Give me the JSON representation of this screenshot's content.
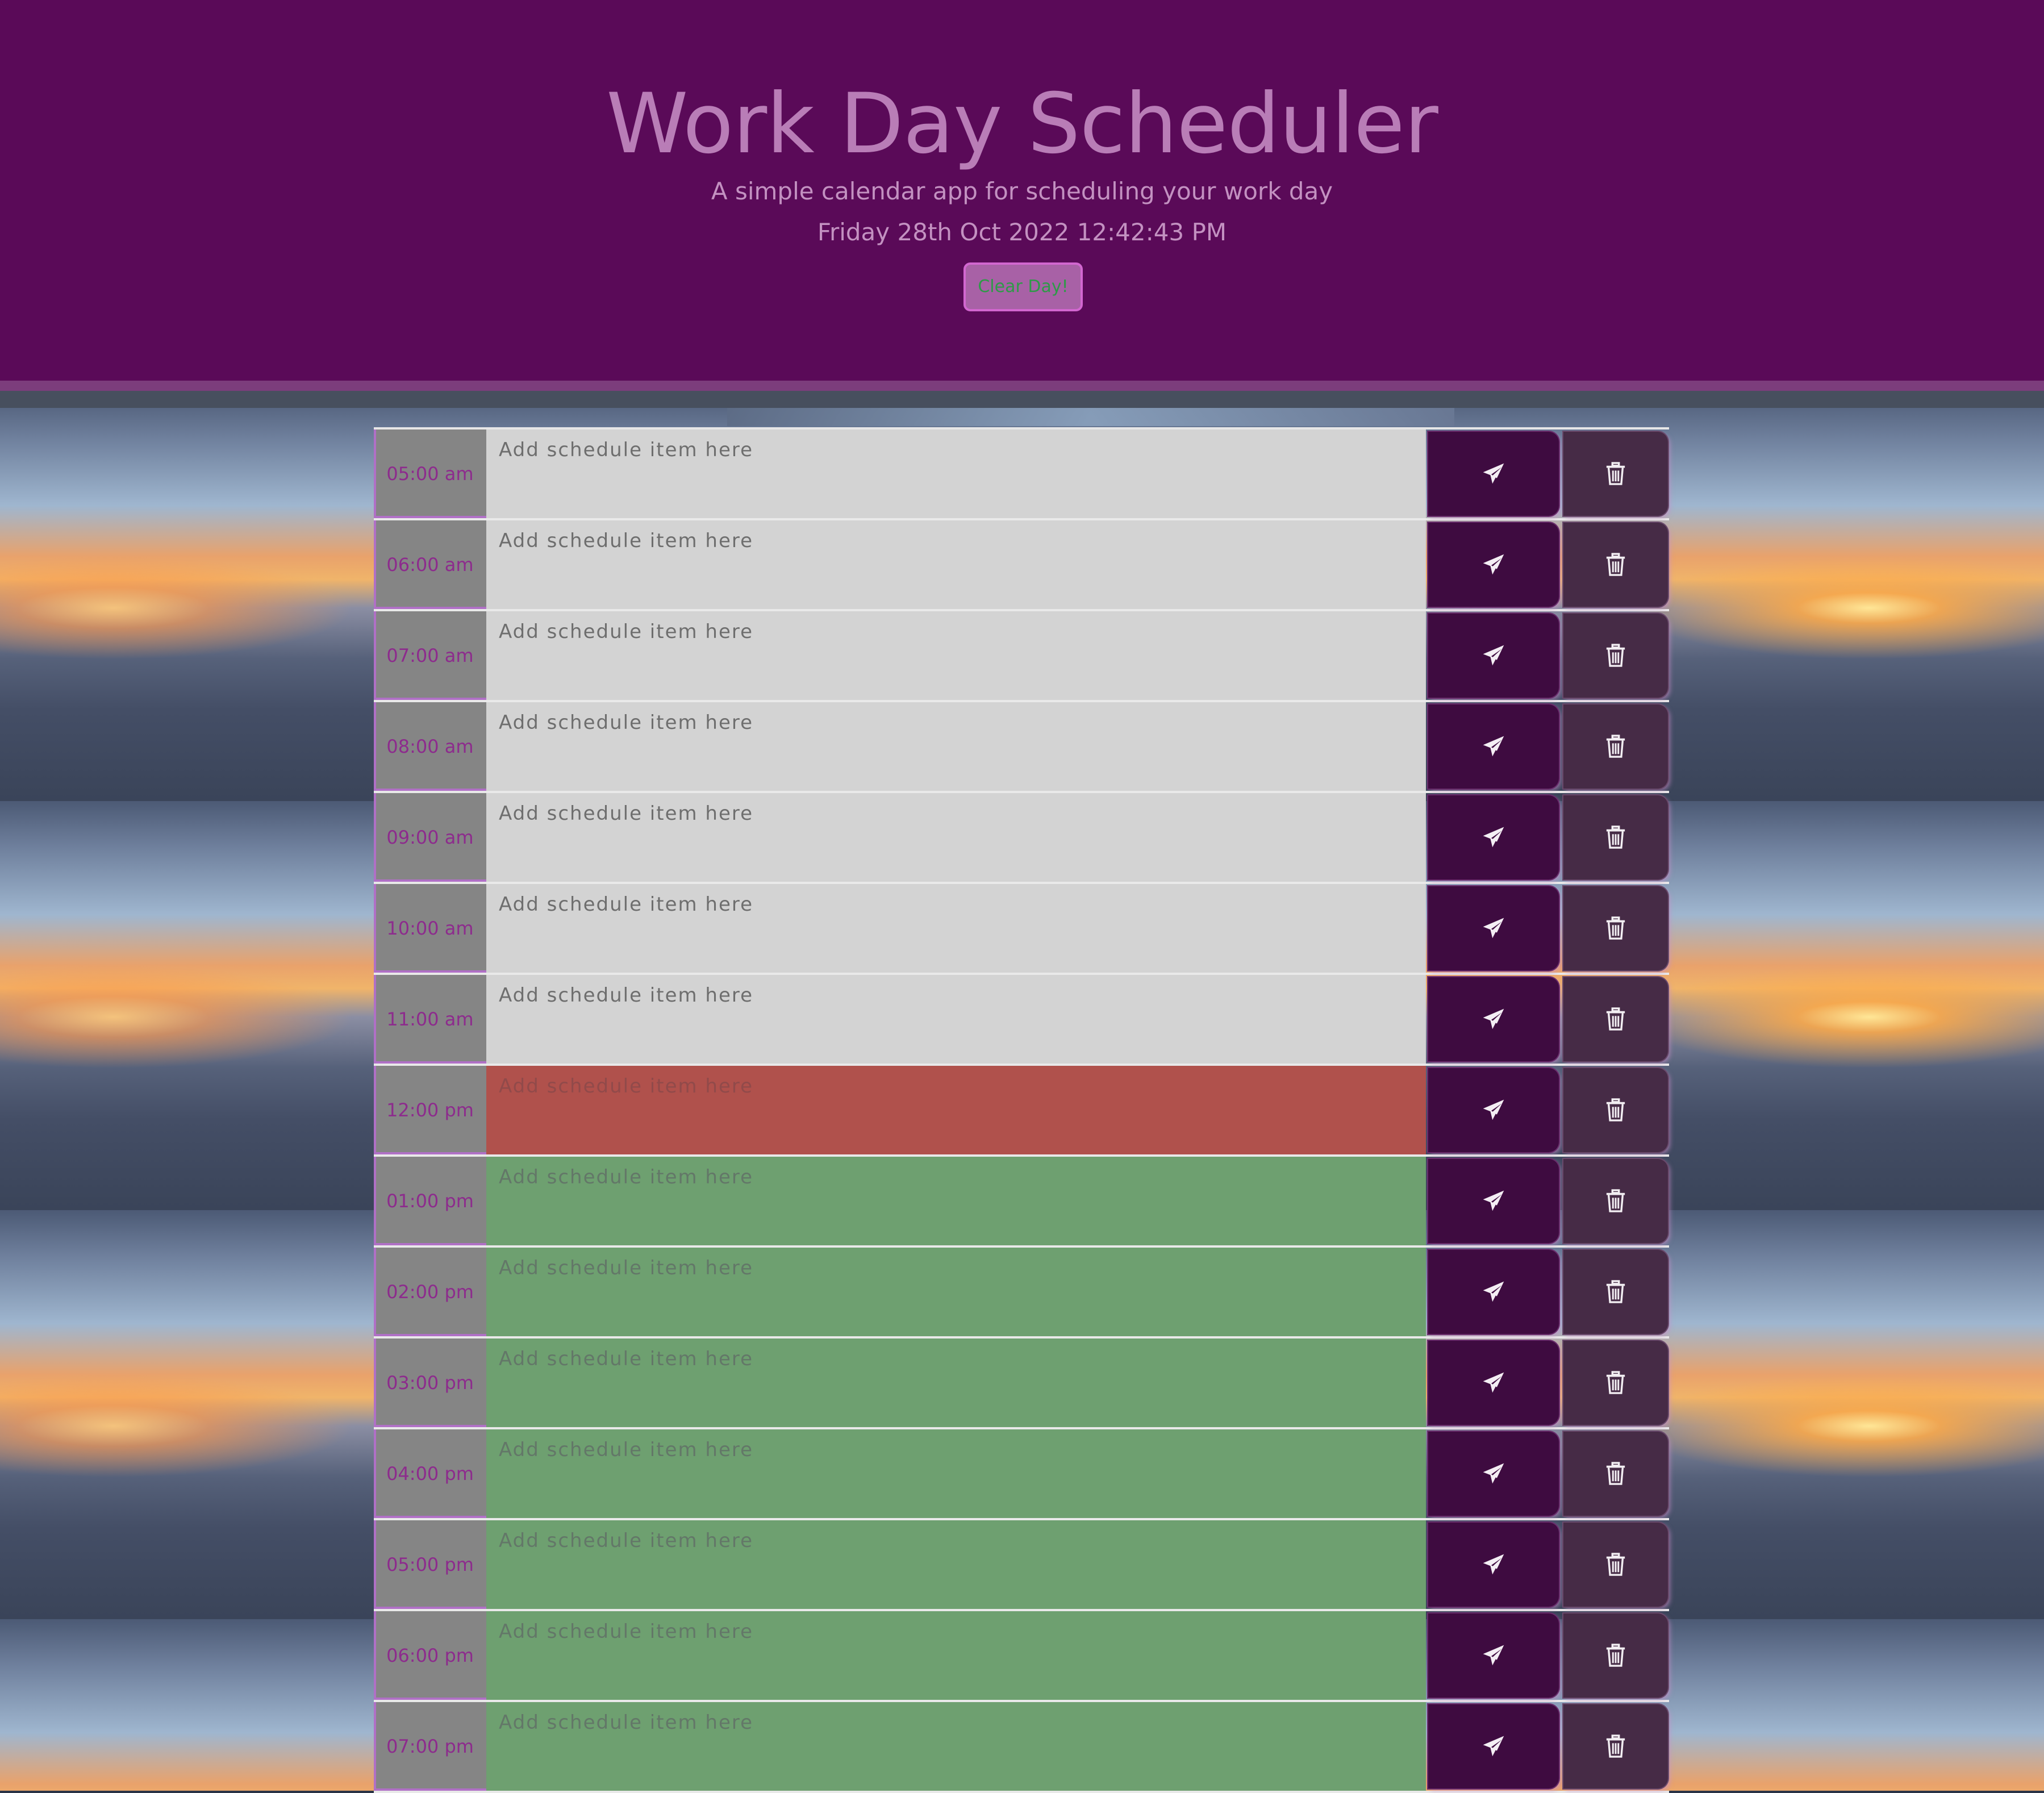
{
  "header": {
    "title": "Work Day Scheduler",
    "subtitle": "A simple calendar app for scheduling your work day",
    "current_datetime": "Friday 28th Oct 2022 12:42:43 PM",
    "clear_button_label": "Clear Day!"
  },
  "colors": {
    "header_bg": "#5a0a58",
    "past": "#d3d3d3",
    "present": "#b0514c",
    "future": "#6ea070",
    "save_button": "#3e0b40",
    "delete_button": "#462b46"
  },
  "scheduler": {
    "placeholder": "Add schedule item here",
    "save_icon": "paper-plane-icon",
    "delete_icon": "trash-icon",
    "rows": [
      {
        "time": "05:00 am",
        "status": "past",
        "text": ""
      },
      {
        "time": "06:00 am",
        "status": "past",
        "text": ""
      },
      {
        "time": "07:00 am",
        "status": "past",
        "text": ""
      },
      {
        "time": "08:00 am",
        "status": "past",
        "text": ""
      },
      {
        "time": "09:00 am",
        "status": "past",
        "text": ""
      },
      {
        "time": "10:00 am",
        "status": "past",
        "text": ""
      },
      {
        "time": "11:00 am",
        "status": "past",
        "text": ""
      },
      {
        "time": "12:00 pm",
        "status": "present",
        "text": ""
      },
      {
        "time": "01:00 pm",
        "status": "future",
        "text": ""
      },
      {
        "time": "02:00 pm",
        "status": "future",
        "text": ""
      },
      {
        "time": "03:00 pm",
        "status": "future",
        "text": ""
      },
      {
        "time": "04:00 pm",
        "status": "future",
        "text": ""
      },
      {
        "time": "05:00 pm",
        "status": "future",
        "text": ""
      },
      {
        "time": "06:00 pm",
        "status": "future",
        "text": ""
      },
      {
        "time": "07:00 pm",
        "status": "future",
        "text": ""
      }
    ]
  }
}
